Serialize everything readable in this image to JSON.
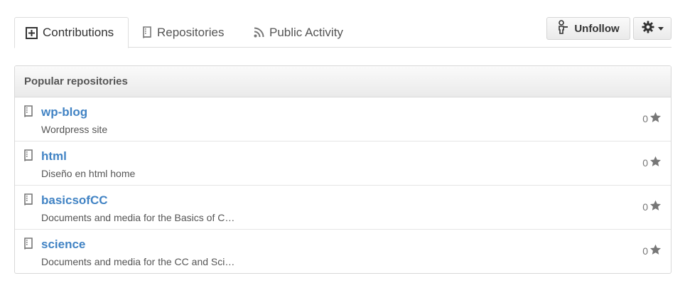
{
  "tabs": [
    {
      "label": "Contributions",
      "icon": "contributions-icon",
      "selected": true
    },
    {
      "label": "Repositories",
      "icon": "repo-icon",
      "selected": false
    },
    {
      "label": "Public Activity",
      "icon": "rss-icon",
      "selected": false
    }
  ],
  "actions": {
    "unfollow_label": "Unfollow",
    "unfollow_icon": "person-minus-icon",
    "settings_icon": "gear-icon"
  },
  "popular": {
    "title": "Popular repositories",
    "repos": [
      {
        "name": "wp-blog",
        "description": "Wordpress site",
        "stars": "0"
      },
      {
        "name": "html",
        "description": "Diseño en html home",
        "stars": "0"
      },
      {
        "name": "basicsofCC",
        "description": "Documents and media for the Basics of C…",
        "stars": "0"
      },
      {
        "name": "science",
        "description": "Documents and media for the CC and Sci…",
        "stars": "0"
      }
    ]
  },
  "colors": {
    "link": "#4183c4",
    "star": "#777777",
    "border": "#d8d8d8"
  }
}
